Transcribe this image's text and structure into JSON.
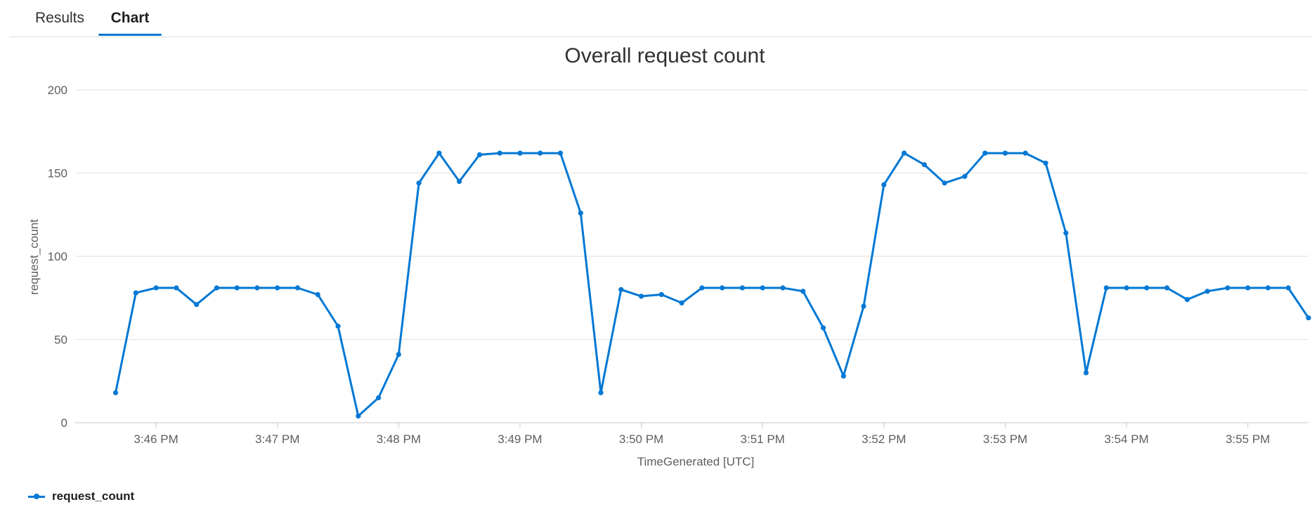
{
  "tabs": {
    "results_label": "Results",
    "chart_label": "Chart",
    "active": "Chart"
  },
  "colors": {
    "series": "#0078d4",
    "grid": "#e1dfdd",
    "accent": "#0078d4"
  },
  "legend": {
    "label": "request_count",
    "placement": "bottom-left"
  },
  "chart_data": {
    "type": "line",
    "title": "Overall request count",
    "xlabel": "TimeGenerated [UTC]",
    "ylabel": "request_count",
    "ylim": [
      0,
      200
    ],
    "yticks": [
      0,
      50,
      100,
      150,
      200
    ],
    "xlim": [
      "3:45:20 PM",
      "3:55:30 PM"
    ],
    "xticks": [
      "3:46 PM",
      "3:47 PM",
      "3:48 PM",
      "3:49 PM",
      "3:50 PM",
      "3:51 PM",
      "3:52 PM",
      "3:53 PM",
      "3:54 PM",
      "3:55 PM"
    ],
    "grid": "horizontal",
    "x": [
      "3:45:40 PM",
      "3:45:50 PM",
      "3:46:00 PM",
      "3:46:10 PM",
      "3:46:20 PM",
      "3:46:30 PM",
      "3:46:40 PM",
      "3:46:50 PM",
      "3:47:00 PM",
      "3:47:10 PM",
      "3:47:20 PM",
      "3:47:30 PM",
      "3:47:40 PM",
      "3:47:50 PM",
      "3:48:00 PM",
      "3:48:10 PM",
      "3:48:20 PM",
      "3:48:30 PM",
      "3:48:40 PM",
      "3:48:50 PM",
      "3:49:00 PM",
      "3:49:10 PM",
      "3:49:20 PM",
      "3:49:30 PM",
      "3:49:40 PM",
      "3:49:50 PM",
      "3:50:00 PM",
      "3:50:10 PM",
      "3:50:20 PM",
      "3:50:30 PM",
      "3:50:40 PM",
      "3:50:50 PM",
      "3:51:00 PM",
      "3:51:10 PM",
      "3:51:20 PM",
      "3:51:30 PM",
      "3:51:40 PM",
      "3:51:50 PM",
      "3:52:00 PM",
      "3:52:10 PM",
      "3:52:20 PM",
      "3:52:30 PM",
      "3:52:40 PM",
      "3:52:50 PM",
      "3:53:00 PM",
      "3:53:10 PM",
      "3:53:20 PM",
      "3:53:30 PM",
      "3:53:40 PM",
      "3:53:50 PM",
      "3:54:00 PM",
      "3:54:10 PM",
      "3:54:20 PM",
      "3:54:30 PM",
      "3:54:40 PM",
      "3:54:50 PM",
      "3:55:00 PM",
      "3:55:10 PM",
      "3:55:20 PM",
      "3:55:30 PM"
    ],
    "series": [
      {
        "name": "request_count",
        "values": [
          18,
          78,
          81,
          81,
          71,
          81,
          81,
          81,
          81,
          81,
          77,
          58,
          4,
          15,
          41,
          144,
          162,
          145,
          161,
          162,
          162,
          162,
          162,
          126,
          18,
          80,
          76,
          77,
          72,
          81,
          81,
          81,
          81,
          81,
          79,
          57,
          28,
          70,
          143,
          162,
          155,
          144,
          148,
          162,
          162,
          162,
          156,
          114,
          30,
          81,
          81,
          81,
          81,
          74,
          79,
          81,
          81,
          81,
          81,
          63
        ]
      }
    ]
  }
}
